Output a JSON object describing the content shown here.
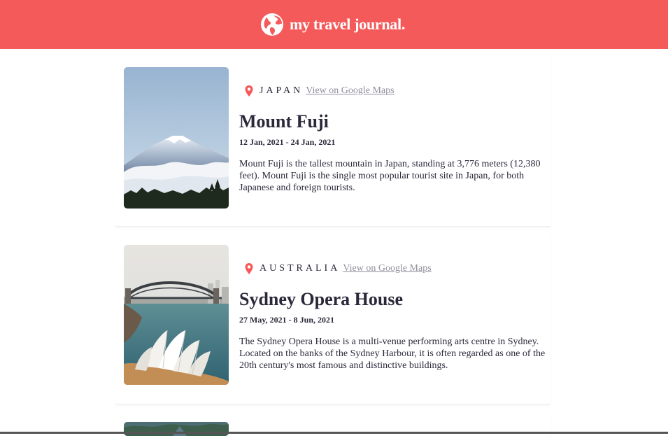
{
  "header": {
    "title": "my travel journal.",
    "icon": "globe-icon",
    "background": "#f55a5a"
  },
  "entries": [
    {
      "country": "JAPAN",
      "maps_link": "View on Google Maps",
      "title": "Mount Fuji",
      "dates": "12 Jan, 2021 - 24 Jan, 2021",
      "description": "Mount Fuji is the tallest mountain in Japan, standing at 3,776 meters (12,380 feet). Mount Fuji is the single most popular tourist site in Japan, for both Japanese and foreign tourists.",
      "image": "mount-fuji-photo"
    },
    {
      "country": "AUSTRALIA",
      "maps_link": "View on Google Maps",
      "title": "Sydney Opera House",
      "dates": "27 May, 2021 - 8 Jun, 2021",
      "description": "The Sydney Opera House is a multi-venue performing arts centre in Sydney. Located on the banks of the Sydney Harbour, it is often regarded as one of the 20th century's most famous and distinctive buildings.",
      "image": "sydney-opera-house-photo"
    }
  ],
  "colors": {
    "accent": "#f55a5a",
    "text": "#2b283a",
    "link": "#918e9b"
  }
}
